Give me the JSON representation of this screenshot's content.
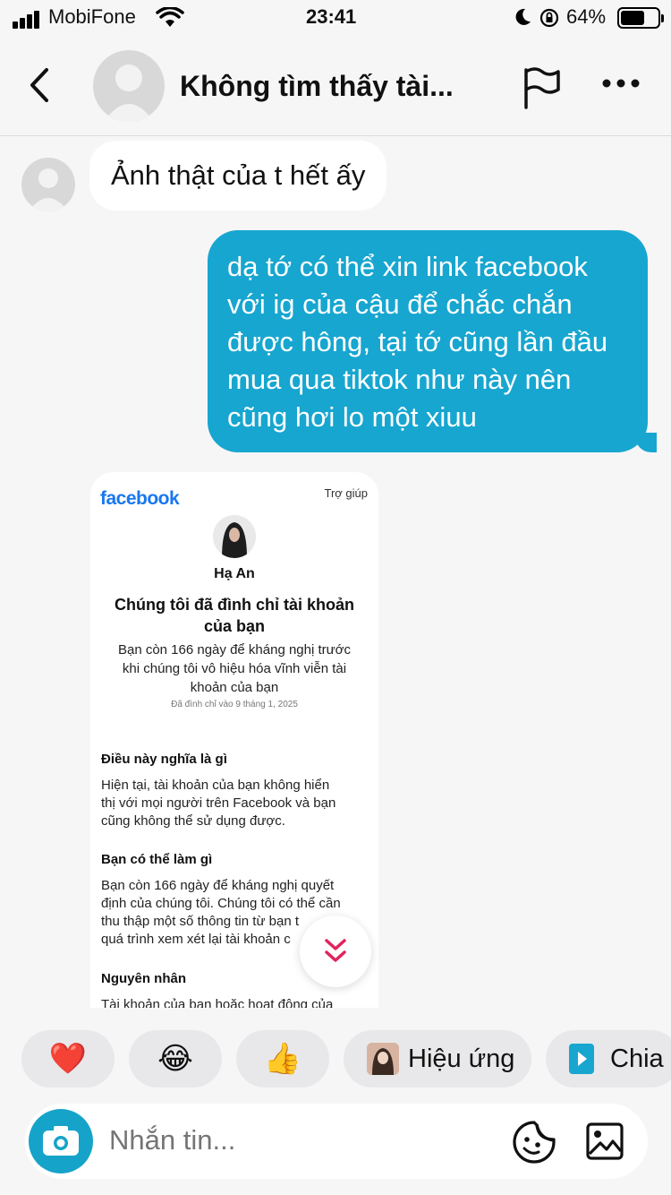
{
  "status_bar": {
    "carrier": "MobiFone",
    "time": "23:41",
    "battery_percent": "64%",
    "battery_level": 0.64
  },
  "header": {
    "title": "Không tìm thấy tài...",
    "icons": [
      "chevron-left-icon",
      "flag-icon",
      "more-icon"
    ]
  },
  "messages": {
    "incoming_text": "Ảnh thật của t hết ấy",
    "outgoing_lines": [
      "dạ tớ có thể xin link facebook",
      "với ig của cậu để chắc chắn",
      "được hông, tại tớ cũng lần đầu",
      "mua qua tiktok như này nên",
      "cũng hơi lo một xiuu"
    ]
  },
  "shared_image": {
    "logo": "facebook",
    "help": "Trợ giúp",
    "name": "Hạ An",
    "heading_lines": [
      "Chúng tôi đã đình chỉ tài khoản",
      "của bạn"
    ],
    "subtitle_lines": [
      "Bạn còn 166 ngày để kháng nghị trước",
      "khi chúng tôi vô hiệu hóa vĩnh viễn tài",
      "khoản của bạn"
    ],
    "date": "Đã đình chỉ vào 9 tháng 1, 2025",
    "section1_title": "Điều này nghĩa là gì",
    "section1_lines": [
      "Hiện tại, tài khoản của bạn không hiển",
      "thị với mọi người trên Facebook và bạn",
      "cũng không thể sử dụng được."
    ],
    "section2_title": "Bạn có thể làm gì",
    "section2_lines": [
      "Bạn còn 166 ngày để kháng nghị quyết",
      "định của chúng tôi. Chúng tôi có thể cần",
      "thu thập một số thông tin từ bạn t",
      "quá trình xem xét lại tài khoản c"
    ],
    "section3_title": "Nguyên nhân",
    "section3_line": "Tài khoản của bạn hoặc hoạt động của"
  },
  "reactions": {
    "heart": "❤️",
    "laugh": "😂",
    "thumbs": "👍",
    "effects_label": "Hiệu ứng",
    "share_label": "Chia s"
  },
  "composer": {
    "placeholder": "Nhắn tin...",
    "icons": [
      "camera-icon",
      "sticker-icon",
      "gallery-icon"
    ]
  },
  "colors": {
    "accent": "#17a6d0",
    "facebook_blue": "#1877f2",
    "background": "#f6f6f7",
    "chip": "#e8e8ea"
  }
}
